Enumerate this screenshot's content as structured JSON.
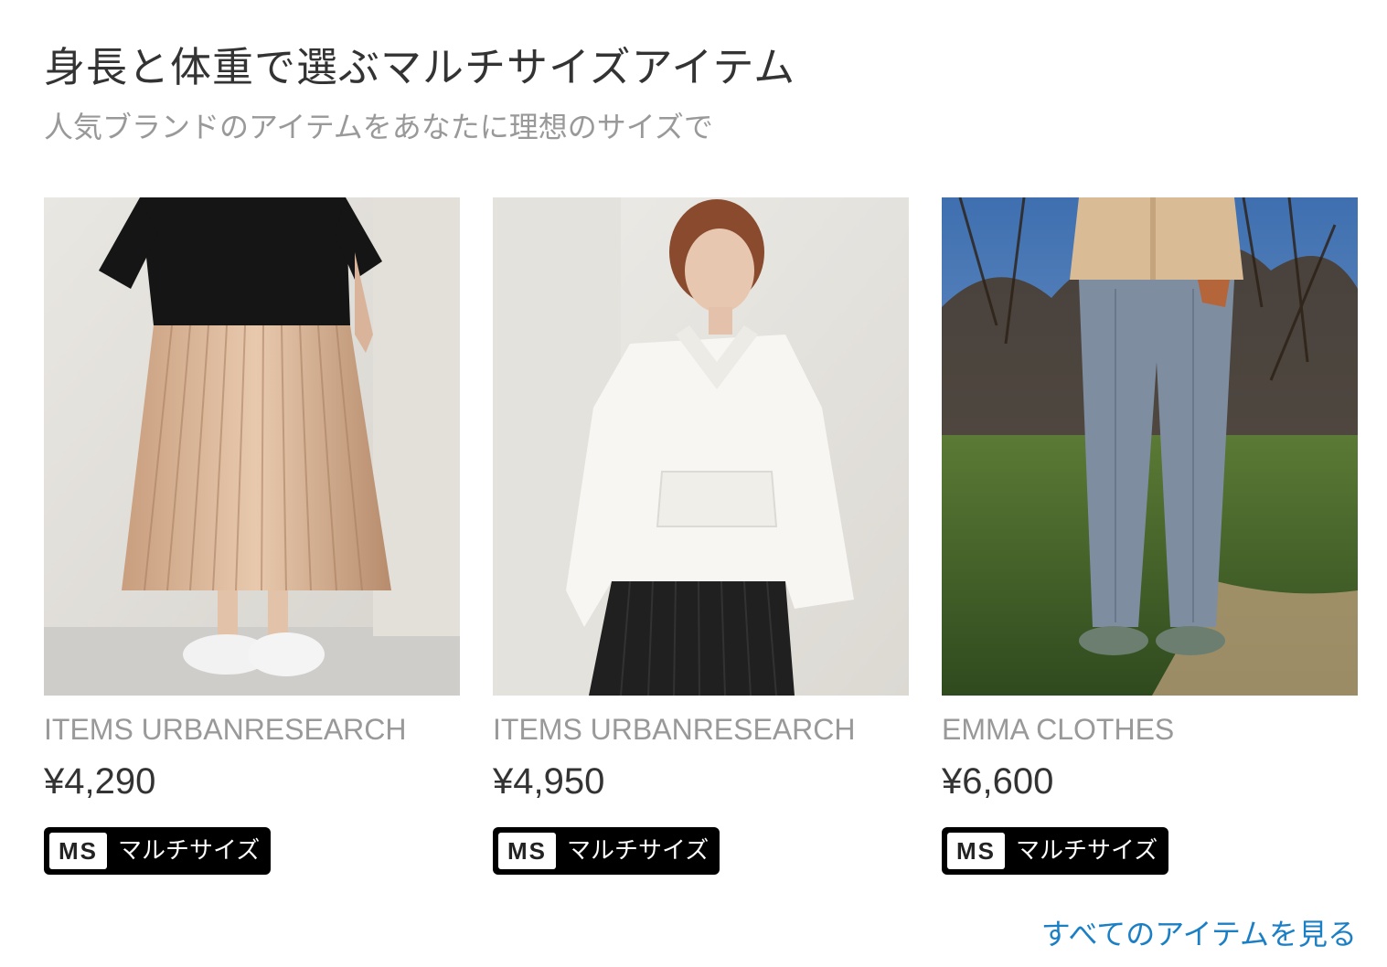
{
  "header": {
    "title": "身長と体重で選ぶマルチサイズアイテム",
    "subtitle": "人気ブランドのアイテムをあなたに理想のサイズで"
  },
  "products": [
    {
      "brand": "ITEMS URBANRESEARCH",
      "price": "¥4,290",
      "badge_code": "MS",
      "badge_label": "マルチサイズ",
      "image": "pleated-skirt-photo"
    },
    {
      "brand": "ITEMS URBANRESEARCH",
      "price": "¥4,950",
      "badge_code": "MS",
      "badge_label": "マルチサイズ",
      "image": "white-hoodie-photo"
    },
    {
      "brand": "EMMA CLOTHES",
      "price": "¥6,600",
      "badge_code": "MS",
      "badge_label": "マルチサイズ",
      "image": "grey-trousers-photo"
    }
  ],
  "footer": {
    "view_all_label": "すべてのアイテムを見る"
  },
  "colors": {
    "link": "#1a7fc4",
    "badge_bg": "#000000",
    "muted_text": "#999999",
    "body_text": "#333333"
  }
}
